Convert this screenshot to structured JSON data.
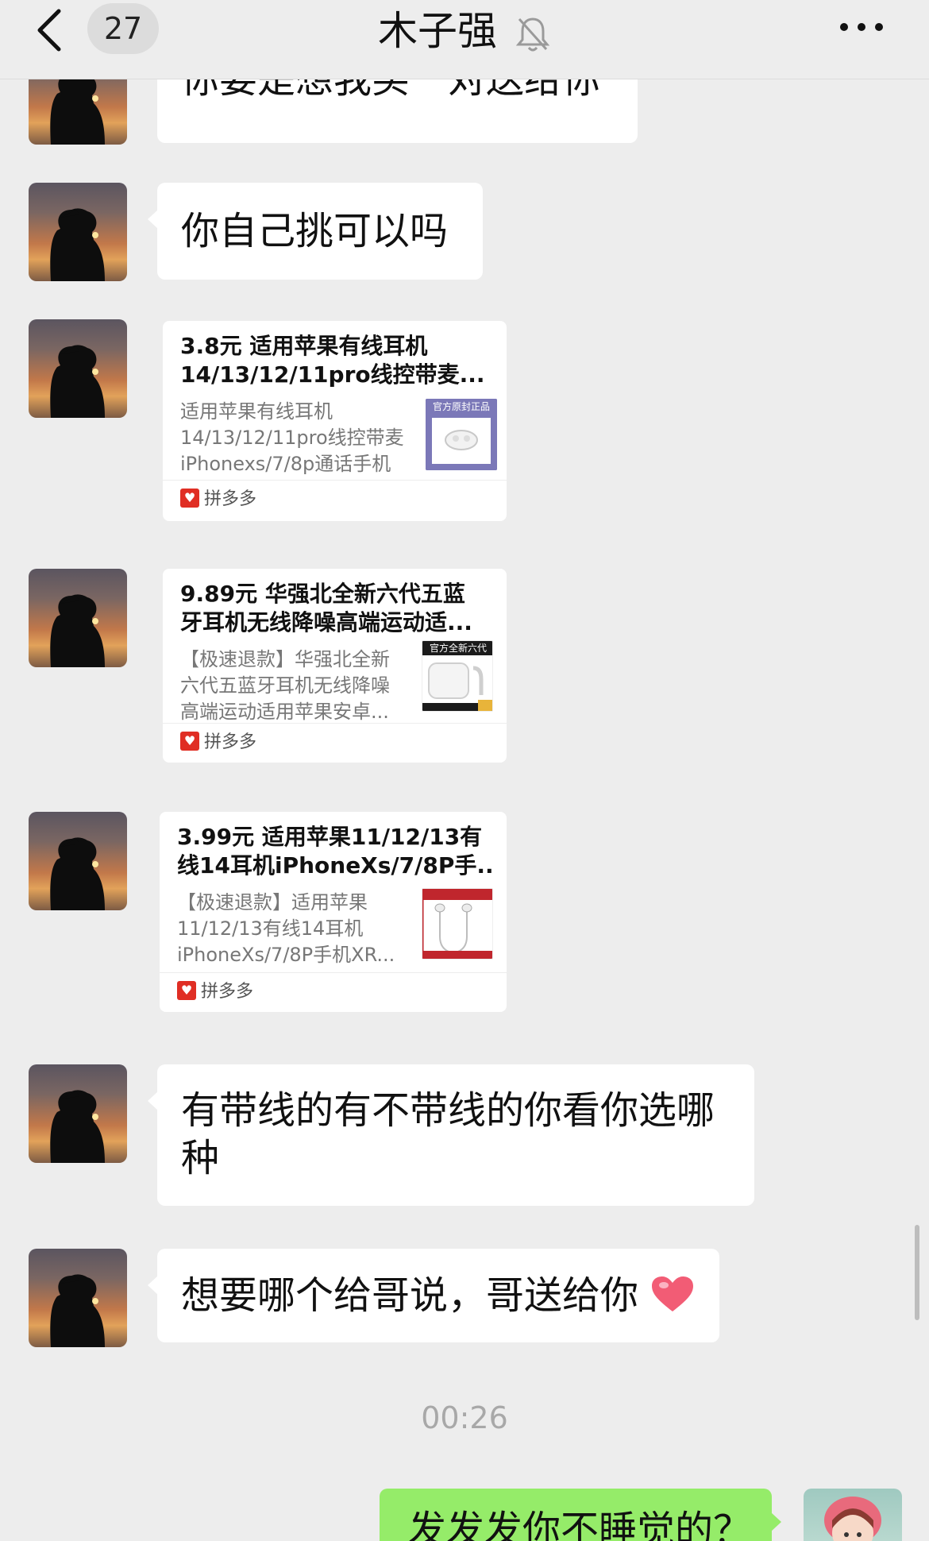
{
  "header": {
    "unread_count": "27",
    "title": "木子强",
    "icons": {
      "back": "chevron-left-icon",
      "mute": "bell-muted-icon",
      "more": "more-dots-icon"
    }
  },
  "messages": {
    "m1": "你要是想我买一对送给你",
    "m2": "你自己挑可以吗",
    "m3_line1": "有带线的有不带线的你看你选哪",
    "m3_line2": "种",
    "m4": "想要哪个给哥说，哥送给你",
    "m4_emoji": "heart-emoji",
    "sent1": "发发发你不睡觉的？"
  },
  "cards": [
    {
      "title_line1": "3.8元 适用苹果有线耳机",
      "title_line2": "14/13/12/11pro线控带麦...",
      "desc_line1": "适用苹果有线耳机",
      "desc_line2": "14/13/12/11pro线控带麦",
      "desc_line3": "iPhonexs/7/8p通话手机",
      "thumb_text": "官方原封正品",
      "source": "拼多多"
    },
    {
      "title_line1": "9.89元 华强北全新六代五蓝",
      "title_line2": "牙耳机无线降噪高端运动适...",
      "desc_line1": "【极速退款】华强北全新",
      "desc_line2": "六代五蓝牙耳机无线降噪",
      "desc_line3": "高端运动适用苹果安卓...",
      "thumb_text": "官方全新六代",
      "source": "拼多多"
    },
    {
      "title_line1": "3.99元 适用苹果11/12/13有",
      "title_line2": "线14耳机iPhoneXs/7/8P手...",
      "desc_line1": "【极速退款】适用苹果",
      "desc_line2": "11/12/13有线14耳机",
      "desc_line3": "iPhoneXs/7/8P手机XR...",
      "thumb_text": "",
      "source": "拼多多"
    }
  ],
  "timestamp": "00:26",
  "colors": {
    "background": "#ededed",
    "bubble_in": "#ffffff",
    "bubble_out": "#95ec69",
    "pdd_red": "#e02e24"
  }
}
